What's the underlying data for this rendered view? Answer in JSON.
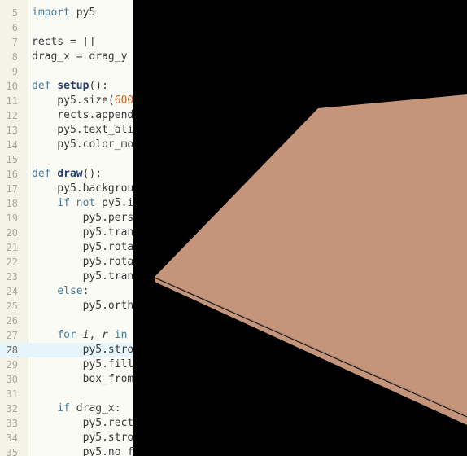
{
  "editor": {
    "lines": [
      {
        "num": "5",
        "code": "import py5",
        "active": false
      },
      {
        "num": "6",
        "code": "",
        "active": false
      },
      {
        "num": "7",
        "code": "rects = []",
        "active": false
      },
      {
        "num": "8",
        "code": "drag_x = drag_y",
        "active": false
      },
      {
        "num": "9",
        "code": "",
        "active": false
      },
      {
        "num": "10",
        "code": "def setup():",
        "active": false
      },
      {
        "num": "11",
        "code": "    py5.size(600",
        "active": false
      },
      {
        "num": "12",
        "code": "    rects.append",
        "active": false
      },
      {
        "num": "13",
        "code": "    py5.text_ali",
        "active": false
      },
      {
        "num": "14",
        "code": "    py5.color_mo",
        "active": false
      },
      {
        "num": "15",
        "code": "",
        "active": false
      },
      {
        "num": "16",
        "code": "def draw():",
        "active": false
      },
      {
        "num": "17",
        "code": "    py5.backgrou",
        "active": false
      },
      {
        "num": "18",
        "code": "    if not py5.i",
        "active": false
      },
      {
        "num": "19",
        "code": "        py5.pers",
        "active": false
      },
      {
        "num": "20",
        "code": "        py5.tran",
        "active": false
      },
      {
        "num": "21",
        "code": "        py5.rota",
        "active": false
      },
      {
        "num": "22",
        "code": "        py5.rota",
        "active": false
      },
      {
        "num": "23",
        "code": "        py5.tran",
        "active": false
      },
      {
        "num": "24",
        "code": "    else:",
        "active": false
      },
      {
        "num": "25",
        "code": "        py5.orth",
        "active": false
      },
      {
        "num": "26",
        "code": "",
        "active": false
      },
      {
        "num": "27",
        "code": "    for i, r in",
        "active": false
      },
      {
        "num": "28",
        "code": "        py5.stro",
        "active": true
      },
      {
        "num": "29",
        "code": "        py5.fill",
        "active": false
      },
      {
        "num": "30",
        "code": "        box_from",
        "active": false
      },
      {
        "num": "31",
        "code": "",
        "active": false
      },
      {
        "num": "32",
        "code": "    if drag_x:",
        "active": false
      },
      {
        "num": "33",
        "code": "        py5.rect",
        "active": false
      },
      {
        "num": "34",
        "code": "        py5.stro",
        "active": false
      },
      {
        "num": "35",
        "code": "        py5.no_f",
        "active": false
      }
    ]
  },
  "sketch": {
    "background": "#000000",
    "box_top_color": "#c4957a",
    "box_side_color": "#c4957a",
    "edge_color": "#1a1a1a"
  }
}
